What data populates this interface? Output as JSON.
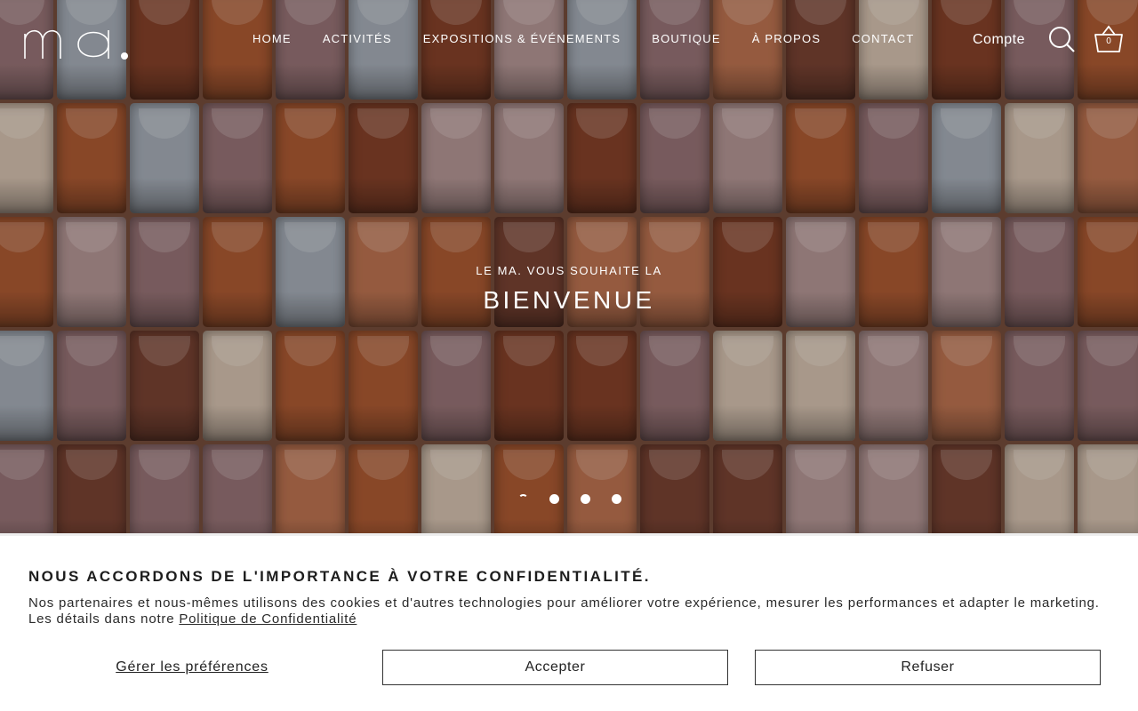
{
  "brand": {
    "logo_text": "ma."
  },
  "nav": {
    "items": [
      {
        "label": "HOME"
      },
      {
        "label": "ACTIVITÉS"
      },
      {
        "label": "EXPOSITIONS & ÉVÉNEMENTS"
      },
      {
        "label": "BOUTIQUE"
      },
      {
        "label": "À PROPOS"
      },
      {
        "label": "CONTACT"
      }
    ],
    "account_label": "Compte",
    "cart_count": "0",
    "icons": [
      "search-icon",
      "basket-icon"
    ]
  },
  "hero": {
    "kicker": "LE MA. VOUS SOUHAITE LA",
    "title": "BIENVENUE",
    "slides": 4,
    "active_slide": 1
  },
  "cookie_banner": {
    "title": "NOUS ACCORDONS DE L'IMPORTANCE À VOTRE CONFIDENTIALITÉ.",
    "text": "Nos partenaires et nous-mêmes utilisons des cookies et d'autres technologies pour améliorer votre expérience, mesurer les performances et adapter le marketing. Les détails dans notre",
    "link_label": "Politique de Confidentialité",
    "preferences_label": "Gérer les préférences",
    "accept_label": "Accepter",
    "refuse_label": "Refuser"
  },
  "colors": {
    "text_dark": "#1d1d1d",
    "hero_overlay_text": "#ffffff",
    "tile_palette": [
      "#7a3a24",
      "#a0522d",
      "#b06a4a",
      "#8c6a6e",
      "#9aa2ad",
      "#c7b5a5",
      "#6e3b2d",
      "#a88c8c"
    ]
  }
}
